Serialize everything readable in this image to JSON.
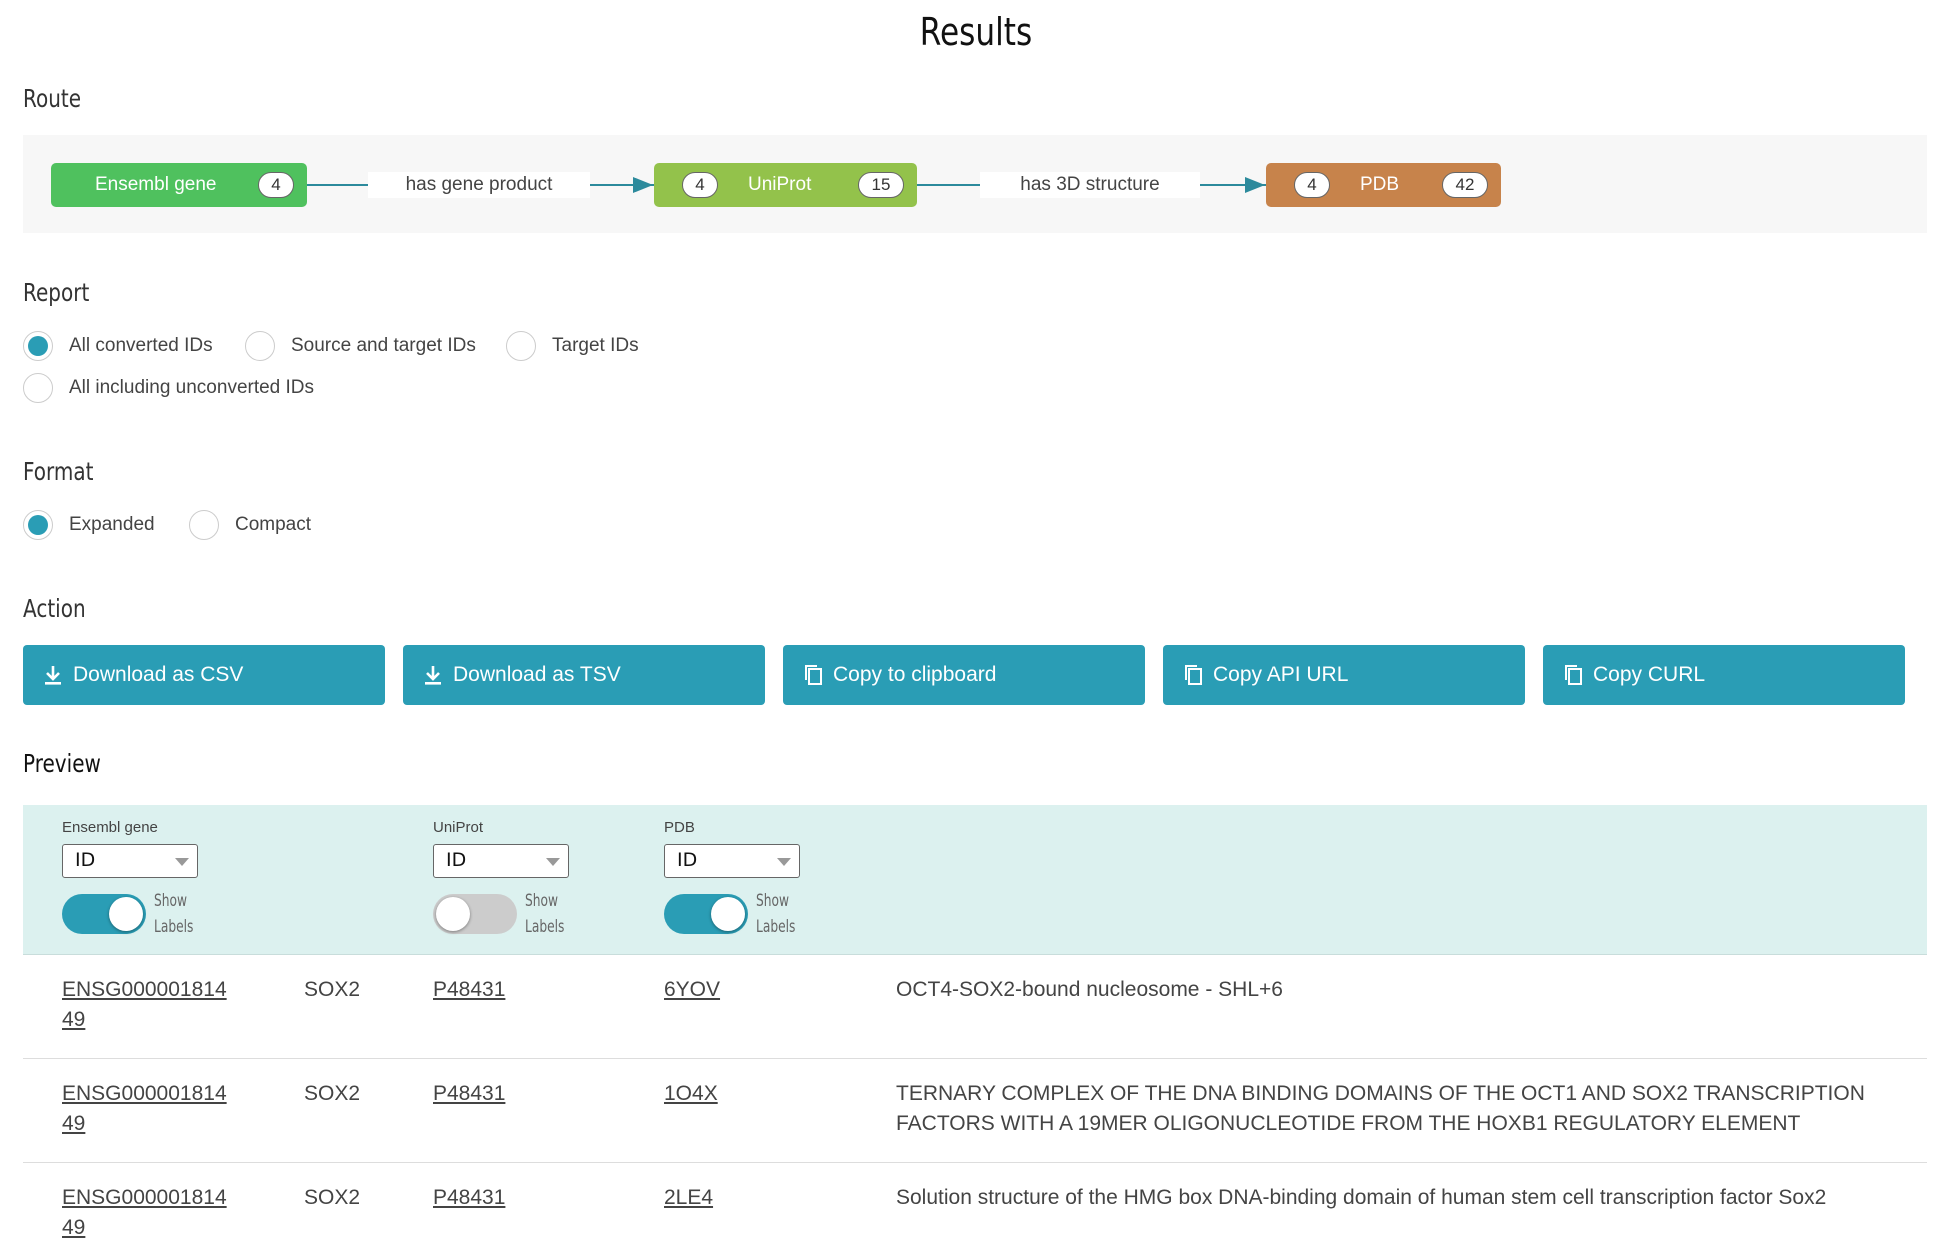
{
  "title": "Results",
  "sections": {
    "route": "Route",
    "report": "Report",
    "format": "Format",
    "action": "Action",
    "preview": "Preview"
  },
  "route": {
    "nodes": [
      {
        "label": "Ensembl gene",
        "count_right": "4",
        "color": "#4fc15e"
      },
      {
        "label": "UniProt",
        "count_left": "4",
        "count_right": "15",
        "color": "#93c24b"
      },
      {
        "label": "PDB",
        "count_left": "4",
        "count_right": "42",
        "color": "#c7834b"
      }
    ],
    "edges": [
      "has gene product",
      "has 3D structure"
    ]
  },
  "report": {
    "options": [
      "All converted IDs",
      "Source and target IDs",
      "Target IDs",
      "All including unconverted IDs"
    ],
    "selected": "All converted IDs"
  },
  "format": {
    "options": [
      "Expanded",
      "Compact"
    ],
    "selected": "Expanded"
  },
  "actions": [
    {
      "label": "Download as CSV",
      "icon": "download-icon"
    },
    {
      "label": "Download as TSV",
      "icon": "download-icon"
    },
    {
      "label": "Copy to clipboard",
      "icon": "copy-icon"
    },
    {
      "label": "Copy API URL",
      "icon": "copy-icon"
    },
    {
      "label": "Copy CURL",
      "icon": "copy-icon"
    }
  ],
  "preview": {
    "columns": [
      {
        "name": "Ensembl gene",
        "select": "ID",
        "show_labels": true,
        "toggle_label": "Show Labels"
      },
      {
        "name": "UniProt",
        "select": "ID",
        "show_labels": false,
        "toggle_label": "Show Labels"
      },
      {
        "name": "PDB",
        "select": "ID",
        "show_labels": true,
        "toggle_label": "Show Labels"
      }
    ],
    "rows": [
      {
        "ensembl": "ENSG00000181449",
        "label": "SOX2",
        "uniprot": "P48431",
        "pdb": "6YOV",
        "desc": "OCT4-SOX2-bound nucleosome - SHL+6"
      },
      {
        "ensembl": "ENSG00000181449",
        "label": "SOX2",
        "uniprot": "P48431",
        "pdb": "1O4X",
        "desc": "TERNARY COMPLEX OF THE DNA BINDING DOMAINS OF THE OCT1 AND SOX2 TRANSCRIPTION FACTORS WITH A 19MER OLIGONUCLEOTIDE FROM THE HOXB1 REGULATORY ELEMENT"
      },
      {
        "ensembl": "ENSG00000181449",
        "label": "SOX2",
        "uniprot": "P48431",
        "pdb": "2LE4",
        "desc": "Solution structure of the HMG box DNA-binding domain of human stem cell transcription factor Sox2"
      }
    ]
  },
  "colors": {
    "accent": "#2a9db5",
    "preview_header_bg": "#dcf1ef",
    "route_bg": "#f7f7f7"
  }
}
